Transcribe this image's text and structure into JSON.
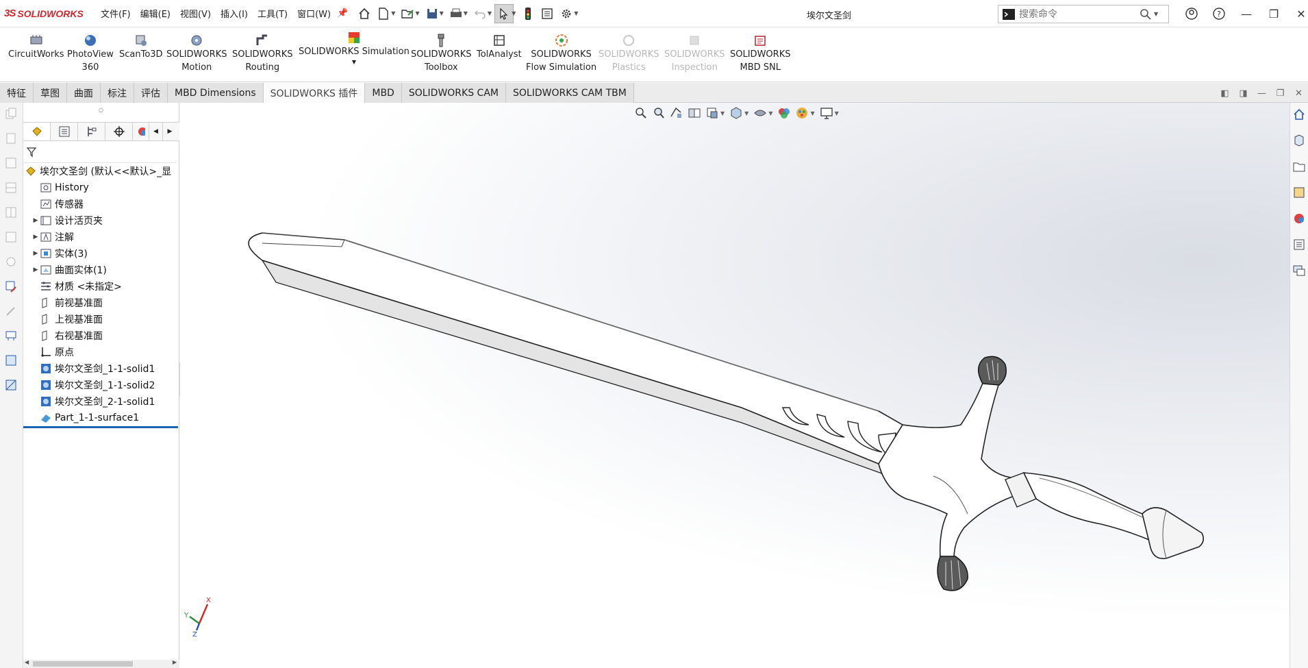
{
  "app": {
    "brand": "SOLIDWORKS",
    "doc_title": "埃尔文圣剑",
    "menu": [
      "文件(F)",
      "编辑(E)",
      "视图(V)",
      "插入(I)",
      "工具(T)",
      "窗口(W)"
    ],
    "search_placeholder": "搜索命令"
  },
  "ribbon": [
    {
      "line1": "CircuitWorks",
      "line2": "",
      "enabled": true
    },
    {
      "line1": "PhotoView",
      "line2": "360",
      "enabled": true
    },
    {
      "line1": "ScanTo3D",
      "line2": "",
      "enabled": true
    },
    {
      "line1": "SOLIDWORKS",
      "line2": "Motion",
      "enabled": true
    },
    {
      "line1": "SOLIDWORKS",
      "line2": "Routing",
      "enabled": true
    },
    {
      "line1": "SOLIDWORKS Simulation",
      "line2": "",
      "enabled": true
    },
    {
      "line1": "SOLIDWORKS",
      "line2": "Toolbox",
      "enabled": true
    },
    {
      "line1": "TolAnalyst",
      "line2": "",
      "enabled": true
    },
    {
      "line1": "SOLIDWORKS",
      "line2": "Flow Simulation",
      "enabled": true
    },
    {
      "line1": "SOLIDWORKS",
      "line2": "Plastics",
      "enabled": false
    },
    {
      "line1": "SOLIDWORKS",
      "line2": "Inspection",
      "enabled": false
    },
    {
      "line1": "SOLIDWORKS",
      "line2": "MBD SNL",
      "enabled": true
    }
  ],
  "tabs": [
    "特征",
    "草图",
    "曲面",
    "标注",
    "评估",
    "MBD Dimensions",
    "SOLIDWORKS 插件",
    "MBD",
    "SOLIDWORKS CAM",
    "SOLIDWORKS CAM TBM"
  ],
  "active_tab": "SOLIDWORKS 插件",
  "tree": {
    "root": "埃尔文圣剑 (默认<<默认>_显",
    "items": [
      {
        "label": "History",
        "expandable": false
      },
      {
        "label": "传感器",
        "expandable": false
      },
      {
        "label": "设计活页夹",
        "expandable": true
      },
      {
        "label": "注解",
        "expandable": true
      },
      {
        "label": "实体(3)",
        "expandable": true
      },
      {
        "label": "曲面实体(1)",
        "expandable": true
      },
      {
        "label": "材质 <未指定>",
        "expandable": false
      },
      {
        "label": "前视基准面",
        "expandable": false
      },
      {
        "label": "上视基准面",
        "expandable": false
      },
      {
        "label": "右视基准面",
        "expandable": false
      },
      {
        "label": "原点",
        "expandable": false
      },
      {
        "label": "埃尔文圣剑_1-1-solid1",
        "expandable": false
      },
      {
        "label": "埃尔文圣剑_1-1-solid2",
        "expandable": false
      },
      {
        "label": "埃尔文圣剑_2-1-solid1",
        "expandable": false
      },
      {
        "label": "Part_1-1-surface1",
        "expandable": false
      }
    ]
  },
  "triad": {
    "x": "X",
    "y": "Y",
    "z": "Z"
  },
  "colors": {
    "brand": "#d0262d",
    "selection": "#1b62b4",
    "axis_x": "#d9231e",
    "axis_y": "#2e8b3a",
    "axis_z": "#1f4fc4"
  }
}
